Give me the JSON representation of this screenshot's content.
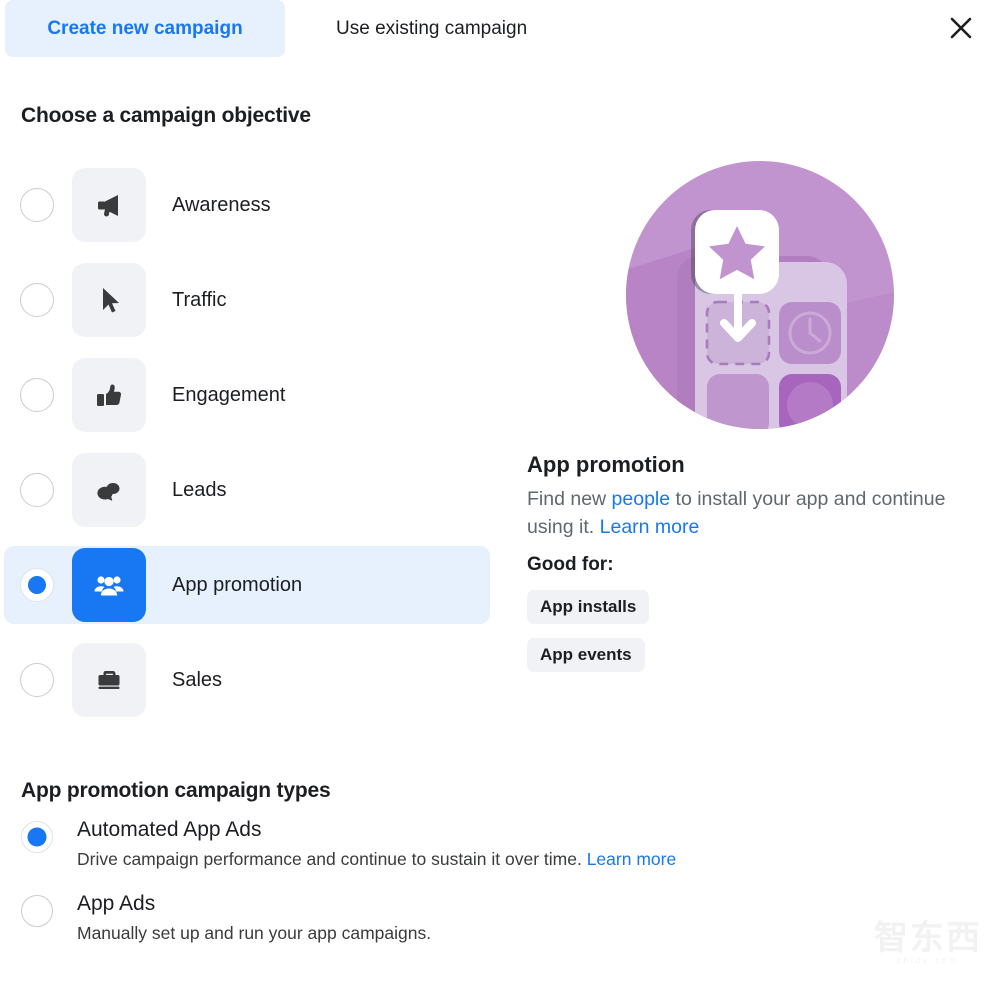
{
  "tabs": [
    {
      "id": "create-new",
      "label": "Create new campaign",
      "active": true
    },
    {
      "id": "use-existing",
      "label": "Use existing campaign",
      "active": false
    }
  ],
  "close_icon": "close-icon",
  "objective_section": {
    "heading": "Choose a campaign objective",
    "items": [
      {
        "id": "awareness",
        "label": "Awareness",
        "icon": "megaphone-icon",
        "selected": false
      },
      {
        "id": "traffic",
        "label": "Traffic",
        "icon": "cursor-icon",
        "selected": false
      },
      {
        "id": "engagement",
        "label": "Engagement",
        "icon": "thumbs-up-icon",
        "selected": false
      },
      {
        "id": "leads",
        "label": "Leads",
        "icon": "chat-bubbles-icon",
        "selected": false
      },
      {
        "id": "app-promotion",
        "label": "App promotion",
        "icon": "people-icon",
        "selected": true
      },
      {
        "id": "sales",
        "label": "Sales",
        "icon": "briefcase-icon",
        "selected": false
      }
    ]
  },
  "detail": {
    "illustration": "app-promotion-illustration",
    "title": "App promotion",
    "desc_part1": "Find new ",
    "desc_link1": "people",
    "desc_part2": " to install your app and continue using it. ",
    "desc_link2": "Learn more",
    "good_for_label": "Good for:",
    "chips": [
      "App installs",
      "App events"
    ]
  },
  "types_section": {
    "heading": "App promotion campaign types",
    "options": [
      {
        "id": "automated-app-ads",
        "title": "Automated App Ads",
        "desc": "Drive campaign performance and continue to sustain it over time. ",
        "link": "Learn more",
        "selected": true
      },
      {
        "id": "app-ads",
        "title": "App Ads",
        "desc": "Manually set up and run your app campaigns.",
        "link": "",
        "selected": false
      }
    ]
  },
  "watermark": {
    "text": "智东西",
    "sub": "zhidx.com"
  },
  "colors": {
    "accent_blue": "#1877f2",
    "selected_row_bg": "#e7f0fd",
    "tile_grey": "#f0f2f5",
    "text_primary": "#1c1e21",
    "text_secondary": "#606770",
    "illustration_purple": "#b889c4"
  }
}
